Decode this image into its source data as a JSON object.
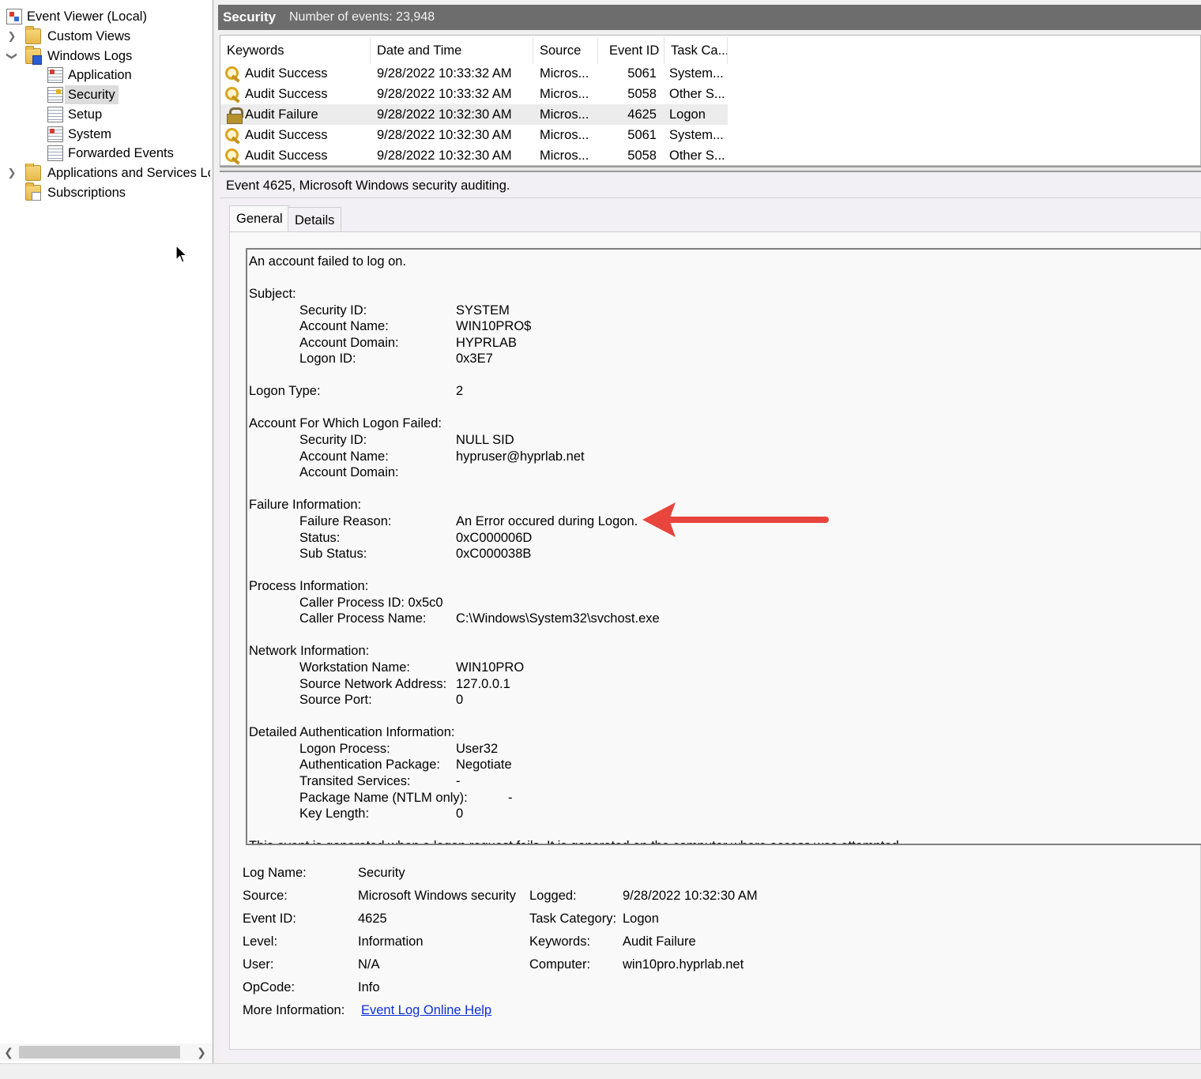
{
  "tree": {
    "root": "Event Viewer (Local)",
    "custom_views": "Custom Views",
    "windows_logs": "Windows Logs",
    "application": "Application",
    "security": "Security",
    "setup": "Setup",
    "system": "System",
    "forwarded_events": "Forwarded Events",
    "apps_services": "Applications and Services Lo",
    "subscriptions": "Subscriptions"
  },
  "header": {
    "log_name": "Security",
    "event_count": "Number of events: 23,948"
  },
  "event_list": {
    "columns": [
      "Keywords",
      "Date and Time",
      "Source",
      "Event ID",
      "Task Ca..."
    ],
    "rows": [
      {
        "keyword": "Audit Success",
        "datetime": "9/28/2022 10:33:32 AM",
        "source": "Micros...",
        "event_id": "5061",
        "task": "System..."
      },
      {
        "keyword": "Audit Success",
        "datetime": "9/28/2022 10:33:32 AM",
        "source": "Micros...",
        "event_id": "5058",
        "task": "Other S..."
      },
      {
        "keyword": "Audit Failure",
        "datetime": "9/28/2022 10:32:30 AM",
        "source": "Micros...",
        "event_id": "4625",
        "task": "Logon"
      },
      {
        "keyword": "Audit Success",
        "datetime": "9/28/2022 10:32:30 AM",
        "source": "Micros...",
        "event_id": "5061",
        "task": "System..."
      },
      {
        "keyword": "Audit Success",
        "datetime": "9/28/2022 10:32:30 AM",
        "source": "Micros...",
        "event_id": "5058",
        "task": "Other S..."
      }
    ]
  },
  "detail": {
    "heading": "Event 4625, Microsoft Windows security auditing.",
    "tabs": [
      "General",
      "Details"
    ],
    "description": {
      "intro": "An account failed to log on.",
      "subject_header": "Subject:",
      "subject": [
        {
          "label": "Security ID:",
          "value": "SYSTEM"
        },
        {
          "label": "Account Name:",
          "value": "WIN10PRO$"
        },
        {
          "label": "Account Domain:",
          "value": "HYPRLAB"
        },
        {
          "label": "Logon ID:",
          "value": "0x3E7"
        }
      ],
      "logon_type_label": "Logon Type:",
      "logon_type_value": "2",
      "failed_header": "Account For Which Logon Failed:",
      "failed": [
        {
          "label": "Security ID:",
          "value": "NULL SID"
        },
        {
          "label": "Account Name:",
          "value": "hypruser@hyprlab.net"
        },
        {
          "label": "Account Domain:",
          "value": ""
        }
      ],
      "failure_header": "Failure Information:",
      "failure": [
        {
          "label": "Failure Reason:",
          "value": "An Error occured during Logon."
        },
        {
          "label": "Status:",
          "value": "0xC000006D"
        },
        {
          "label": "Sub Status:",
          "value": "0xC000038B"
        }
      ],
      "process_header": "Process Information:",
      "caller_pid": "Caller Process ID:  0x5c0",
      "caller_name_label": "Caller Process Name:",
      "caller_name_value": "C:\\Windows\\System32\\svchost.exe",
      "network_header": "Network Information:",
      "network": [
        {
          "label": "Workstation Name:",
          "value": "WIN10PRO"
        },
        {
          "label": "Source Network Address:",
          "value": "127.0.0.1"
        },
        {
          "label": "Source Port:",
          "value": "0"
        }
      ],
      "auth_header": "Detailed Authentication Information:",
      "auth": [
        {
          "label": "Logon Process:",
          "value": "User32"
        },
        {
          "label": "Authentication Package:",
          "value": "Negotiate"
        },
        {
          "label": "Transited Services:",
          "value": "-"
        },
        {
          "label": "Package Name (NTLM only):",
          "value": "-"
        },
        {
          "label": "Key Length:",
          "value": "0"
        }
      ],
      "trailer": "This event is generated when a logon request fails. It is generated on the computer where access was attempted."
    },
    "properties": {
      "log_name_label": "Log Name:",
      "log_name": "Security",
      "source_label": "Source:",
      "source": "Microsoft Windows security",
      "logged_label": "Logged:",
      "logged": "9/28/2022 10:32:30 AM",
      "event_id_label": "Event ID:",
      "event_id": "4625",
      "task_category_label": "Task Category:",
      "task_category": "Logon",
      "level_label": "Level:",
      "level": "Information",
      "keywords_label": "Keywords:",
      "keywords": "Audit Failure",
      "user_label": "User:",
      "user": "N/A",
      "computer_label": "Computer:",
      "computer": "win10pro.hyprlab.net",
      "opcode_label": "OpCode:",
      "opcode": "Info",
      "more_info_label": "More Information:",
      "more_info_link": "Event Log Online Help"
    }
  },
  "annotation": {
    "arrow_color": "#e8453c"
  }
}
